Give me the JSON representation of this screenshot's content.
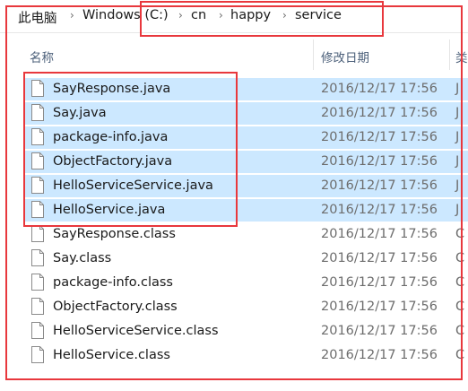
{
  "breadcrumb": {
    "items": [
      "此电脑",
      "Windows (C:)",
      "cn",
      "happy",
      "service"
    ],
    "separator": "›"
  },
  "columns": {
    "name": "名称",
    "modified": "修改日期",
    "type": "类"
  },
  "files": [
    {
      "name": "SayResponse.java",
      "modified": "2016/12/17 17:56",
      "type": "J",
      "selected": true
    },
    {
      "name": "Say.java",
      "modified": "2016/12/17 17:56",
      "type": "J",
      "selected": true
    },
    {
      "name": "package-info.java",
      "modified": "2016/12/17 17:56",
      "type": "J",
      "selected": true
    },
    {
      "name": "ObjectFactory.java",
      "modified": "2016/12/17 17:56",
      "type": "J",
      "selected": true
    },
    {
      "name": "HelloServiceService.java",
      "modified": "2016/12/17 17:56",
      "type": "J",
      "selected": true
    },
    {
      "name": "HelloService.java",
      "modified": "2016/12/17 17:56",
      "type": "J",
      "selected": true
    },
    {
      "name": "SayResponse.class",
      "modified": "2016/12/17 17:56",
      "type": "C",
      "selected": false
    },
    {
      "name": "Say.class",
      "modified": "2016/12/17 17:56",
      "type": "C",
      "selected": false
    },
    {
      "name": "package-info.class",
      "modified": "2016/12/17 17:56",
      "type": "C",
      "selected": false
    },
    {
      "name": "ObjectFactory.class",
      "modified": "2016/12/17 17:56",
      "type": "C",
      "selected": false
    },
    {
      "name": "HelloServiceService.class",
      "modified": "2016/12/17 17:56",
      "type": "C",
      "selected": false
    },
    {
      "name": "HelloService.class",
      "modified": "2016/12/17 17:56",
      "type": "C",
      "selected": false
    }
  ],
  "colors": {
    "selection": "#cce8ff",
    "annotation": "#e8383d",
    "header_text": "#4c607a"
  },
  "icons": {
    "file": "file-icon",
    "separator": "chevron-right-icon"
  }
}
